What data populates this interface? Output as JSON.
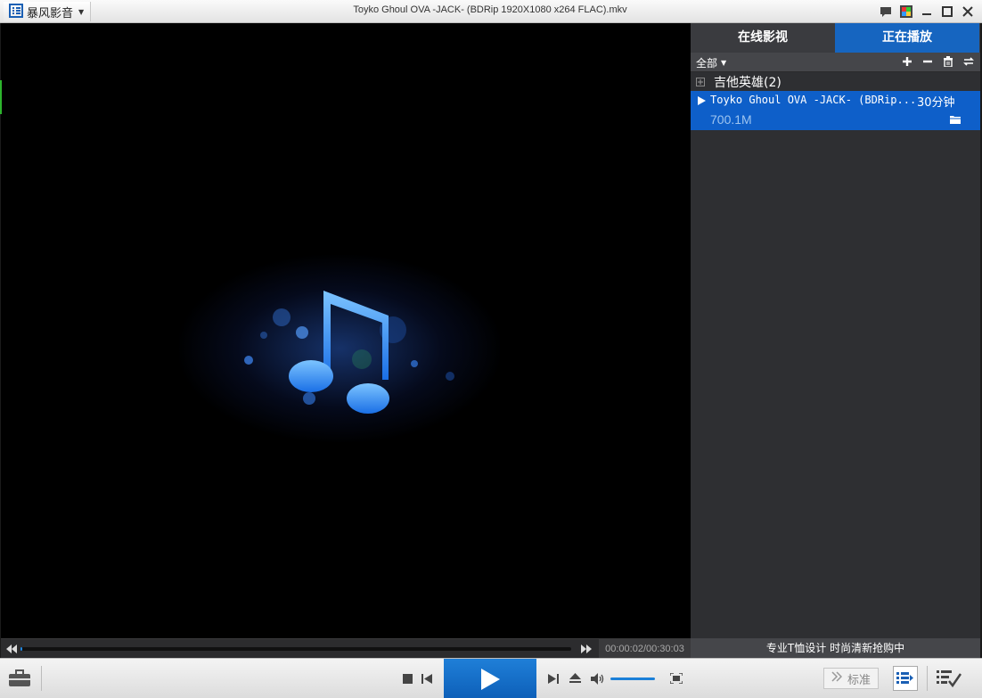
{
  "window": {
    "app_name": "暴风影音",
    "title": "Toyko Ghoul OVA -JACK- (BDRip 1920X1080 x264 FLAC).mkv"
  },
  "sidebar": {
    "tabs": [
      {
        "label": "在线影视",
        "active": false
      },
      {
        "label": "正在播放",
        "active": true
      }
    ],
    "filter_label": "全部",
    "group": {
      "label": "吉他英雄(2)"
    },
    "playing_item": {
      "title": "Toyko Ghoul OVA -JACK- (BDRip...",
      "duration": "30分钟",
      "size": "700.1M"
    },
    "ad_text": "专业T恤设计 时尚清新抢购中"
  },
  "player": {
    "time": "00:00:02/00:30:03",
    "progress_fraction": 0.001,
    "quality_label": "标准"
  },
  "colors": {
    "accent": "#1665c0",
    "selected_row": "#0e5fc9",
    "sidebar_bg": "#2e2f32"
  }
}
